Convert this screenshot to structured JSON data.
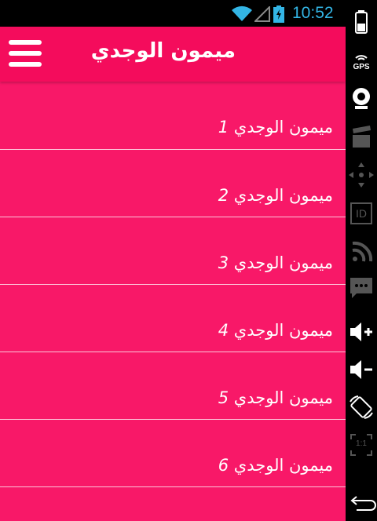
{
  "status_bar": {
    "time": "10:52"
  },
  "app_bar": {
    "title": "ميمون الوجدي"
  },
  "items": [
    {
      "label": "ميمون الوجدي",
      "number": "1"
    },
    {
      "label": "ميمون الوجدي",
      "number": "2"
    },
    {
      "label": "ميمون الوجدي",
      "number": "3"
    },
    {
      "label": "ميمون الوجدي",
      "number": "4"
    },
    {
      "label": "ميمون الوجدي",
      "number": "5"
    },
    {
      "label": "ميمون الوجدي",
      "number": "6"
    }
  ],
  "side_rail": {
    "gps_label": "GPS",
    "id_label": "ID",
    "ratio_label": "1:1"
  },
  "colors": {
    "primary": "#f81868",
    "action_bar": "#f40c5c",
    "clock": "#33b5e5"
  }
}
